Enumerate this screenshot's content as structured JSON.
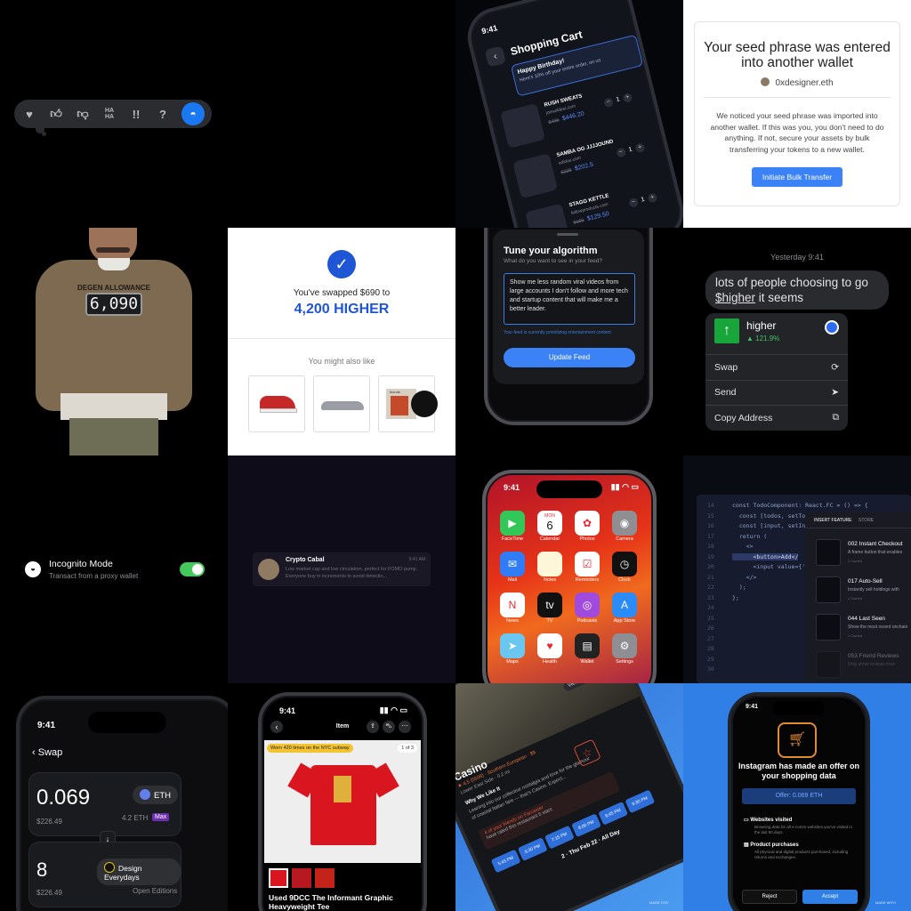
{
  "reactions": {
    "icons": [
      "heart-icon",
      "thumbs-up-icon",
      "thumbs-down-icon",
      "haha-icon",
      "exclamation-icon",
      "question-icon",
      "custom-reaction-icon"
    ],
    "haha": "HA HA",
    "exclaim": "!!",
    "question": "?"
  },
  "cart": {
    "time": "9:41",
    "title": "Shopping Cart",
    "banner_title": "Happy Birthday!",
    "banner_text": "Here's 10% off your entire order, on us",
    "items": [
      {
        "name": "RUSH SWEATS",
        "store": "joinwildest.com",
        "old": "$496",
        "price": "$446.20",
        "qty": "1"
      },
      {
        "name": "SAMBA OG JJJJOUND",
        "store": "adidas.com",
        "old": "$225",
        "price": "$202.5",
        "qty": "1"
      },
      {
        "name": "STAGG KETTLE",
        "store": "fellowproducts.com",
        "old": "$165",
        "price": "$129.50",
        "qty": "1"
      }
    ]
  },
  "seed": {
    "title": "Your seed phrase was entered into another wallet",
    "user": "0xdesigner.eth",
    "body": "We noticed your seed phrase was imported into another wallet. If this was you, you don't need to do anything. If not, secure your assets by bulk transferring your tokens to a new wallet.",
    "button": "Initiate Bulk Transfer"
  },
  "sweater": {
    "label": "DEGEN ALLOWANCE",
    "value": "6,090"
  },
  "swapok": {
    "line": "You've swapped $690 to",
    "amount": "4,200 HIGHER",
    "also": "You might also like",
    "album_title": "blonde"
  },
  "algo": {
    "title": "Tune your algorithm",
    "subtitle": "What do you want to see in your feed?",
    "input": "Show me less random viral videos from large accounts I don't follow and more tech and startup content that will make me a better leader.",
    "note": "Your feed is currently prioritizing entertainment content",
    "button": "Update Feed"
  },
  "msg": {
    "timestamp": "Yesterday 9:41",
    "bubble_pre": "lots of people choosing to go",
    "token": "$higher",
    "bubble_post": " it seems",
    "coin": "higher",
    "change": "▲ 121.9%",
    "actions": [
      "Swap",
      "Send",
      "Copy Address"
    ]
  },
  "incognito": {
    "title": "Incognito Mode",
    "subtitle": "Transact from a proxy wallet",
    "enabled": true
  },
  "notif": {
    "sender": "Crypto Cabal",
    "time": "9:41 AM",
    "body": "Low market cap and low circulation, perfect for FOMO pump. Everyone buy in increments to avoid detectio..."
  },
  "home": {
    "time": "9:41",
    "apps": [
      {
        "label": "FaceTime",
        "color": "#33c759"
      },
      {
        "label": "Calendar",
        "color": "#ffffff"
      },
      {
        "label": "Photos",
        "color": "#ffffff"
      },
      {
        "label": "Camera",
        "color": "#8e8e93"
      },
      {
        "label": "Mail",
        "color": "#2f7cf6"
      },
      {
        "label": "Notes",
        "color": "#fdf6d8"
      },
      {
        "label": "Reminders",
        "color": "#ffffff"
      },
      {
        "label": "Clock",
        "color": "#111111"
      },
      {
        "label": "News",
        "color": "#ffffff"
      },
      {
        "label": "TV",
        "color": "#111111"
      },
      {
        "label": "Podcasts",
        "color": "#a04bde"
      },
      {
        "label": "App Store",
        "color": "#2b8bf7"
      },
      {
        "label": "Maps",
        "color": "#6cc7f0"
      },
      {
        "label": "Health",
        "color": "#ffffff"
      },
      {
        "label": "Wallet",
        "color": "#222222"
      },
      {
        "label": "Settings",
        "color": "#8e8e93"
      }
    ],
    "cal_day": "MON",
    "cal_date": "6"
  },
  "code": {
    "lines": [
      {
        "n": "14",
        "t": "const TodoComponent: React.FC = () => {"
      },
      {
        "n": "15",
        "t": "  const [todos, setTodos"
      },
      {
        "n": "16",
        "t": "  const [input, setInput"
      },
      {
        "n": "17",
        "t": "  return ("
      },
      {
        "n": "18",
        "t": "    <>"
      },
      {
        "n": "19",
        "t": "      <button>Add</"
      },
      {
        "n": "20",
        "t": "      <input value={''}"
      },
      {
        "n": "21",
        "t": "    </>"
      },
      {
        "n": "22",
        "t": "  );"
      },
      {
        "n": "23",
        "t": "};"
      },
      {
        "n": "24",
        "t": ""
      },
      {
        "n": "25",
        "t": ""
      },
      {
        "n": "26",
        "t": ""
      },
      {
        "n": "27",
        "t": ""
      },
      {
        "n": "28",
        "t": ""
      },
      {
        "n": "29",
        "t": ""
      },
      {
        "n": "30",
        "t": ""
      }
    ],
    "tabs": [
      "INSERT FEATURE",
      "STORE"
    ],
    "features": [
      {
        "title": "002 Instant Checkout",
        "desc": "A frame button that enables",
        "meta": "3 Owned"
      },
      {
        "title": "017 Auto-Sell",
        "desc": "Instantly sell holdings with",
        "meta": "1 Owned"
      },
      {
        "title": "044 Last Seen",
        "desc": "Show the most recent onchain",
        "meta": "1 Owned"
      },
      {
        "title": "053 Friend Reviews",
        "desc": "Only show reviews from",
        "meta": ""
      }
    ]
  },
  "swap": {
    "time": "9:41",
    "title": "Swap",
    "amount1": "0.069",
    "usd1": "$226.49",
    "token1": "ETH",
    "bal1": "4.2 ETH",
    "max": "Max",
    "amount2": "8",
    "usd2": "$226.49",
    "token2": "Design Everydays",
    "note2": "Open Editions"
  },
  "item": {
    "time": "9:41",
    "title": "Item",
    "badge": "Worn 420 times on the NYC subway",
    "page": "1 of 3",
    "name": "Used 9DCC The Informant Graphic Heavyweight Tee"
  },
  "casino": {
    "view": "View All",
    "name": "Casino",
    "rating": "★ 4.5 (5508) · Southern European · $$",
    "area": "Lower East Side · 0.2 mi",
    "why": "Why We Like It",
    "desc": "Leaning into our collective nostalgia and love for the glamour of coastal Italian fare — that's Casino. Expect...",
    "friends_a": "4 of your friends on Farcaster",
    "friends_b": "have rated this restaurant 5 stars",
    "slots": [
      "5:45 PM",
      "6:30 PM",
      "7:15 PM",
      "8:00 PM",
      "8:45 PM",
      "9:30 PM"
    ],
    "footer": "2 · Thu Feb 22 · All Day",
    "made": "MADE FOR"
  },
  "offer": {
    "time": "9:41",
    "title": "Instagram has made an offer on your shopping data",
    "offer": "Offer: 0.069 ETH",
    "f1_title": "Websites visited",
    "f1_desc": "Browsing data for all e-comm websites you've visited in the last 90 days.",
    "f2_title": "Product purchases",
    "f2_desc": "All physical and digital products purchased, including returns and exchanges.",
    "reject": "Reject",
    "accept": "Accept",
    "made": "MADE WITH"
  }
}
